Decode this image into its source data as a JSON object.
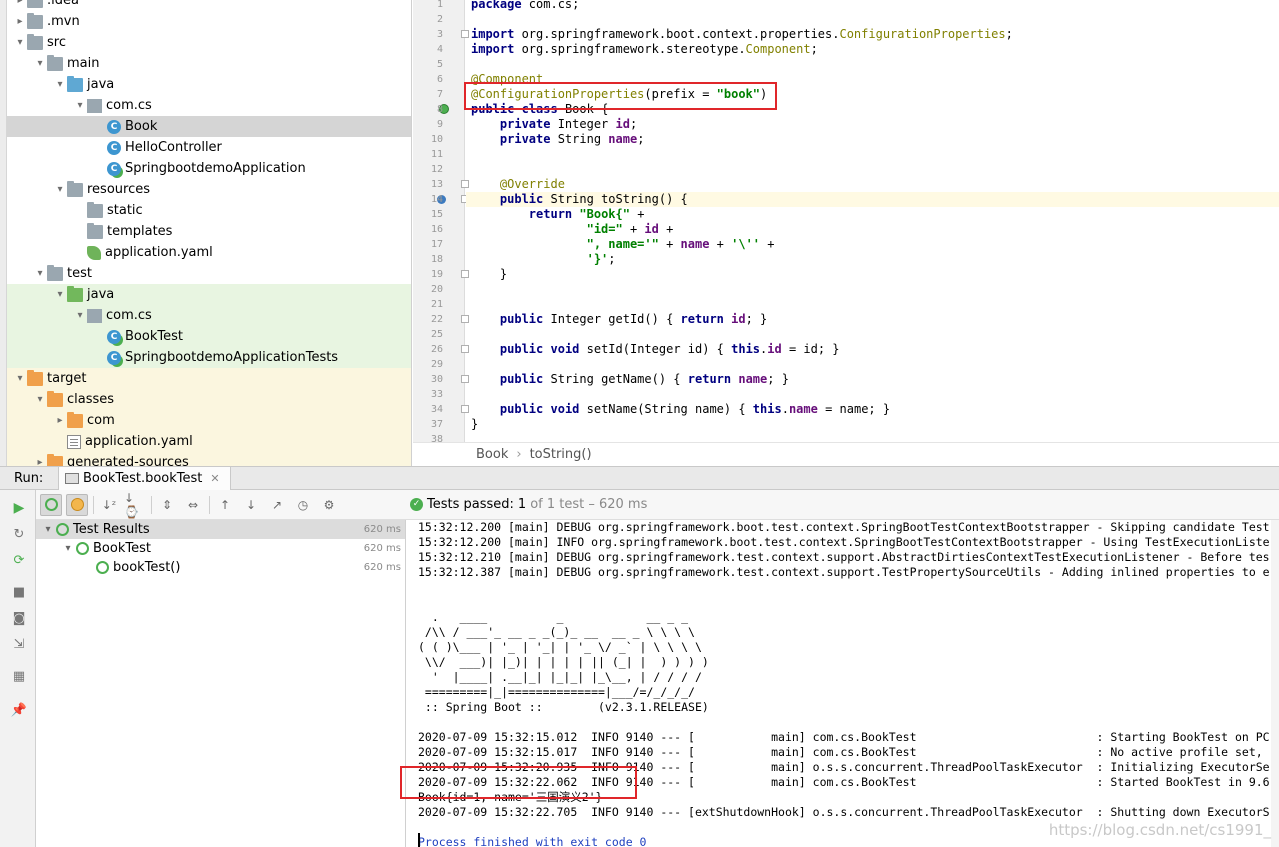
{
  "tree": [
    {
      "label": ".idea",
      "type": "folder",
      "arrow": "›",
      "indent": 1
    },
    {
      "label": ".mvn",
      "type": "folder",
      "arrow": "›",
      "indent": 1
    },
    {
      "label": "src",
      "type": "folder",
      "arrow": "⌄",
      "indent": 1
    },
    {
      "label": "main",
      "type": "folder",
      "arrow": "⌄",
      "indent": 2
    },
    {
      "label": "java",
      "type": "folder-src",
      "arrow": "⌄",
      "indent": 3
    },
    {
      "label": "com.cs",
      "type": "pkg",
      "arrow": "⌄",
      "indent": 4
    },
    {
      "label": "Book",
      "type": "cls",
      "arrow": "",
      "indent": 5,
      "selected": true
    },
    {
      "label": "HelloController",
      "type": "cls",
      "arrow": "",
      "indent": 5
    },
    {
      "label": "SpringbootdemoApplication",
      "type": "cls-run",
      "arrow": "",
      "indent": 5
    },
    {
      "label": "resources",
      "type": "folder-res",
      "arrow": "⌄",
      "indent": 3
    },
    {
      "label": "static",
      "type": "folder",
      "arrow": "",
      "indent": 4
    },
    {
      "label": "templates",
      "type": "folder",
      "arrow": "",
      "indent": 4
    },
    {
      "label": "application.yaml",
      "type": "yaml",
      "arrow": "",
      "indent": 4
    },
    {
      "label": "test",
      "type": "folder",
      "arrow": "⌄",
      "indent": 2
    },
    {
      "label": "java",
      "type": "folder-test",
      "arrow": "⌄",
      "indent": 3,
      "test": true
    },
    {
      "label": "com.cs",
      "type": "pkg",
      "arrow": "⌄",
      "indent": 4,
      "test": true
    },
    {
      "label": "BookTest",
      "type": "cls-run",
      "arrow": "",
      "indent": 5,
      "test": true
    },
    {
      "label": "SpringbootdemoApplicationTests",
      "type": "cls-run",
      "arrow": "",
      "indent": 5,
      "test": true
    },
    {
      "label": "target",
      "type": "folder-exc",
      "arrow": "⌄",
      "indent": 1,
      "exc": true
    },
    {
      "label": "classes",
      "type": "folder-exc",
      "arrow": "⌄",
      "indent": 2,
      "exc": true
    },
    {
      "label": "com",
      "type": "folder-exc",
      "arrow": "›",
      "indent": 3,
      "exc": true
    },
    {
      "label": "application.yaml",
      "type": "yaml-plain",
      "arrow": "",
      "indent": 3,
      "exc": true
    },
    {
      "label": "generated-sources",
      "type": "folder-exc",
      "arrow": "›",
      "indent": 2,
      "exc": true
    }
  ],
  "editor": {
    "line_numbers": [
      "1",
      "2",
      "3",
      "4",
      "5",
      "6",
      "7",
      "8",
      "9",
      "10",
      "11",
      "12",
      "13",
      "14",
      "15",
      "16",
      "17",
      "18",
      "19",
      "20",
      "21",
      "22",
      "25",
      "26",
      "29",
      "30",
      "33",
      "34",
      "37",
      "38"
    ],
    "lines": [
      [
        {
          "t": "package",
          "c": "kw"
        },
        {
          "t": " com.cs;"
        }
      ],
      [],
      [
        {
          "t": "import",
          "c": "kw"
        },
        {
          "t": " org.springframework.boot.context.properties."
        },
        {
          "t": "ConfigurationProperties",
          "c": "ann"
        },
        {
          "t": ";"
        }
      ],
      [
        {
          "t": "import",
          "c": "kw"
        },
        {
          "t": " org.springframework.stereotype."
        },
        {
          "t": "Component",
          "c": "ann"
        },
        {
          "t": ";"
        }
      ],
      [],
      [
        {
          "t": "@Component",
          "c": "ann"
        }
      ],
      [
        {
          "t": "@ConfigurationProperties",
          "c": "ann"
        },
        {
          "t": "(prefix = "
        },
        {
          "t": "\"book\"",
          "c": "str"
        },
        {
          "t": ")"
        }
      ],
      [
        {
          "t": "public",
          "c": "kw"
        },
        {
          "t": " "
        },
        {
          "t": "class",
          "c": "kw"
        },
        {
          "t": " Book {"
        }
      ],
      [
        {
          "t": "    "
        },
        {
          "t": "private",
          "c": "kw"
        },
        {
          "t": " Integer "
        },
        {
          "t": "id",
          "c": "fld"
        },
        {
          "t": ";"
        }
      ],
      [
        {
          "t": "    "
        },
        {
          "t": "private",
          "c": "kw"
        },
        {
          "t": " String "
        },
        {
          "t": "name",
          "c": "fld"
        },
        {
          "t": ";"
        }
      ],
      [],
      [],
      [
        {
          "t": "    "
        },
        {
          "t": "@Override",
          "c": "ann"
        }
      ],
      [
        {
          "t": "    "
        },
        {
          "t": "public",
          "c": "kw"
        },
        {
          "t": " String toString() {"
        }
      ],
      [
        {
          "t": "        "
        },
        {
          "t": "return",
          "c": "kw"
        },
        {
          "t": " "
        },
        {
          "t": "\"Book{\"",
          "c": "str"
        },
        {
          "t": " +"
        }
      ],
      [
        {
          "t": "                "
        },
        {
          "t": "\"id=\"",
          "c": "str"
        },
        {
          "t": " + "
        },
        {
          "t": "id",
          "c": "fld"
        },
        {
          "t": " +"
        }
      ],
      [
        {
          "t": "                "
        },
        {
          "t": "\", name='\"",
          "c": "str"
        },
        {
          "t": " + "
        },
        {
          "t": "name",
          "c": "fld"
        },
        {
          "t": " + "
        },
        {
          "t": "'\\''",
          "c": "str"
        },
        {
          "t": " +"
        }
      ],
      [
        {
          "t": "                "
        },
        {
          "t": "'}'",
          "c": "str"
        },
        {
          "t": ";"
        }
      ],
      [
        {
          "t": "    }"
        }
      ],
      [],
      [],
      [
        {
          "t": "    "
        },
        {
          "t": "public",
          "c": "kw"
        },
        {
          "t": " Integer getId() { "
        },
        {
          "t": "return",
          "c": "kw"
        },
        {
          "t": " "
        },
        {
          "t": "id",
          "c": "fld"
        },
        {
          "t": "; }"
        }
      ],
      [],
      [
        {
          "t": "    "
        },
        {
          "t": "public",
          "c": "kw"
        },
        {
          "t": " "
        },
        {
          "t": "void",
          "c": "kw"
        },
        {
          "t": " setId(Integer id) { "
        },
        {
          "t": "this",
          "c": "kw"
        },
        {
          "t": "."
        },
        {
          "t": "id",
          "c": "fld"
        },
        {
          "t": " = id; }"
        }
      ],
      [],
      [
        {
          "t": "    "
        },
        {
          "t": "public",
          "c": "kw"
        },
        {
          "t": " String getName() { "
        },
        {
          "t": "return",
          "c": "kw"
        },
        {
          "t": " "
        },
        {
          "t": "name",
          "c": "fld"
        },
        {
          "t": "; }"
        }
      ],
      [],
      [
        {
          "t": "    "
        },
        {
          "t": "public",
          "c": "kw"
        },
        {
          "t": " "
        },
        {
          "t": "void",
          "c": "kw"
        },
        {
          "t": " setName(String name) { "
        },
        {
          "t": "this",
          "c": "kw"
        },
        {
          "t": "."
        },
        {
          "t": "name",
          "c": "fld"
        },
        {
          "t": " = name; }"
        }
      ],
      [
        {
          "t": "}"
        }
      ],
      []
    ],
    "current_line_index": 13,
    "breadcrumb": [
      "Book",
      "toString()"
    ]
  },
  "run": {
    "label": "Run:",
    "tab_title": "BookTest.bookTest",
    "status_prefix": "Tests passed:",
    "status_count": "1",
    "status_suffix": "of 1 test – 620 ms",
    "results": [
      {
        "label": "Test Results",
        "time": "620 ms",
        "indent": 0,
        "arrow": "⌄",
        "selected": true
      },
      {
        "label": "BookTest",
        "time": "620 ms",
        "indent": 1,
        "arrow": "⌄"
      },
      {
        "label": "bookTest()",
        "time": "620 ms",
        "indent": 2,
        "arrow": ""
      }
    ],
    "console": [
      {
        "text": "15:32:12.200 [main] DEBUG org.springframework.boot.test.context.SpringBootTestContextBootstrapper - Skipping candidate Test"
      },
      {
        "text": "15:32:12.200 [main] INFO org.springframework.boot.test.context.SpringBootTestContextBootstrapper - Using TestExecutionListe"
      },
      {
        "text": "15:32:12.210 [main] DEBUG org.springframework.test.context.support.AbstractDirtiesContextTestExecutionListener - Before tes"
      },
      {
        "text": "15:32:12.387 [main] DEBUG org.springframework.test.context.support.TestPropertySourceUtils - Adding inlined properties to e"
      },
      {
        "text": ""
      },
      {
        "text": ""
      },
      {
        "text": "  .   ____          _            __ _ _"
      },
      {
        "text": " /\\\\ / ___'_ __ _ _(_)_ __  __ _ \\ \\ \\ \\"
      },
      {
        "text": "( ( )\\___ | '_ | '_| | '_ \\/ _` | \\ \\ \\ \\"
      },
      {
        "text": " \\\\/  ___)| |_)| | | | | || (_| |  ) ) ) )"
      },
      {
        "text": "  '  |____| .__|_| |_|_| |_\\__, | / / / /"
      },
      {
        "text": " =========|_|==============|___/=/_/_/_/"
      },
      {
        "text": " :: Spring Boot ::        (v2.3.1.RELEASE)"
      },
      {
        "text": ""
      },
      {
        "text": "2020-07-09 15:32:15.012  INFO 9140 --- [           main] com.cs.BookTest                          : Starting BookTest on PC"
      },
      {
        "text": "2020-07-09 15:32:15.017  INFO 9140 --- [           main] com.cs.BookTest                          : No active profile set, "
      },
      {
        "text": "2020-07-09 15:32:20.935  INFO 9140 --- [           main] o.s.s.concurrent.ThreadPoolTaskExecutor  : Initializing ExecutorSe"
      },
      {
        "text": "2020-07-09 15:32:22.062  INFO 9140 --- [           main] com.cs.BookTest                          : Started BookTest in 9.6"
      },
      {
        "text": "Book{id=1, name='三国演义2'}"
      },
      {
        "text": "2020-07-09 15:32:22.705  INFO 9140 --- [extShutdownHook] o.s.s.concurrent.ThreadPoolTaskExecutor  : Shutting down ExecutorS"
      },
      {
        "text": ""
      },
      {
        "text": "Process finished with exit code 0",
        "blue": true
      }
    ],
    "watermark": "https://blog.csdn.net/cs1991_"
  }
}
